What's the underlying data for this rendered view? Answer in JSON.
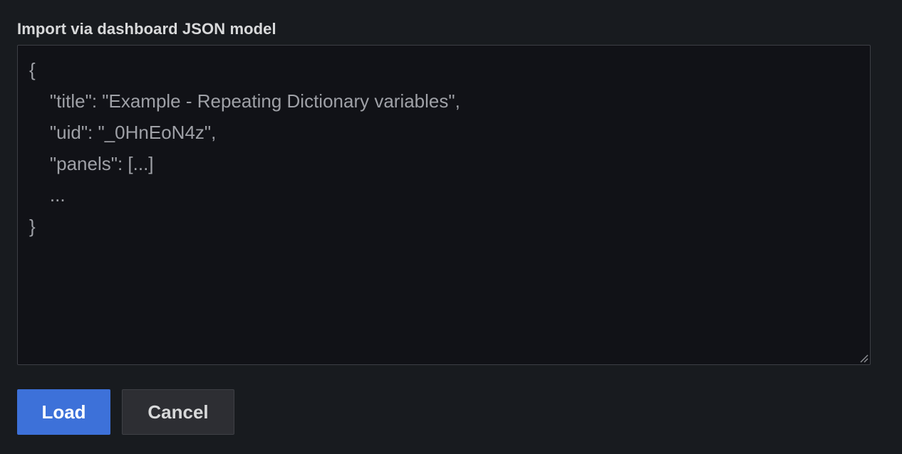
{
  "import_form": {
    "label": "Import via dashboard JSON model",
    "json_textarea": {
      "value": "",
      "placeholder": "{\n    \"title\": \"Example - Repeating Dictionary variables\",\n    \"uid\": \"_0HnEoN4z\",\n    \"panels\": [...]\n    ...\n}"
    },
    "resize_handle_icon": "resize-grip-icon"
  },
  "actions": {
    "load_label": "Load",
    "cancel_label": "Cancel"
  },
  "colors": {
    "background": "#181b1f",
    "textarea_background": "#111217",
    "primary": "#3d71d9",
    "secondary": "#2d2e33",
    "text": "#d8d9da",
    "placeholder": "#9fa1a7"
  }
}
